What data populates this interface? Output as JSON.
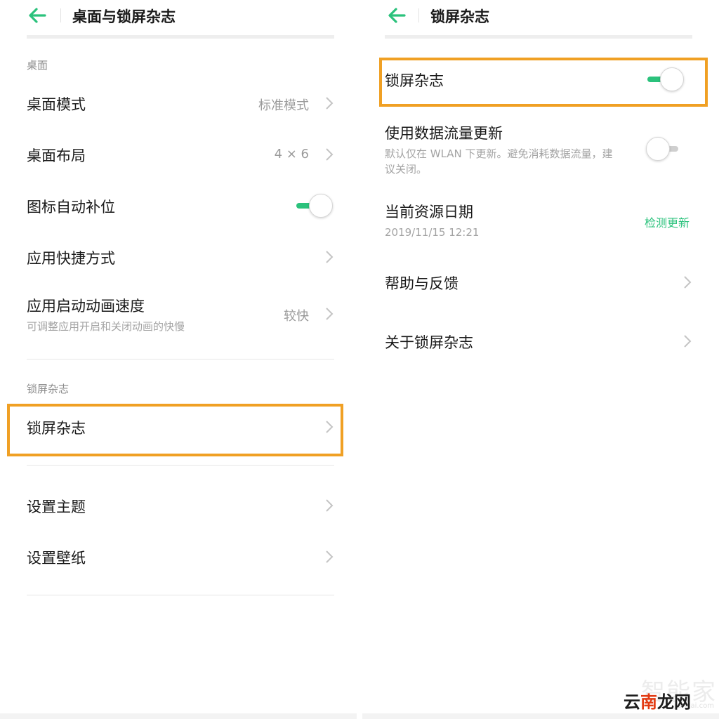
{
  "colors": {
    "accent": "#2bc27c",
    "highlight": "#f0a024",
    "watermark_accent": "#e23a12"
  },
  "icons": {
    "back": "arrow-left-icon",
    "chevron": "chevron-right-icon"
  },
  "left": {
    "title": "桌面与锁屏杂志",
    "section_desktop": "桌面",
    "rows": [
      {
        "title": "桌面模式",
        "value": "标准模式"
      },
      {
        "title": "桌面布局",
        "value": "4 × 6"
      },
      {
        "title": "图标自动补位",
        "toggle": "on"
      },
      {
        "title": "应用快捷方式"
      },
      {
        "title": "应用启动动画速度",
        "subtitle": "可调整应用开启和关闭动画的快慢",
        "value": "较快"
      }
    ],
    "section_lock": "锁屏杂志",
    "lock_row": {
      "title": "锁屏杂志"
    },
    "theme_row": {
      "title": "设置主题"
    },
    "wallpaper_row": {
      "title": "设置壁纸"
    }
  },
  "right": {
    "title": "锁屏杂志",
    "lock_toggle": {
      "title": "锁屏杂志",
      "toggle": "on"
    },
    "data_update": {
      "title": "使用数据流量更新",
      "subtitle_line1": "默认仅在 WLAN 下更新。避免消耗数据流量，建",
      "subtitle_line2": "议关闭。",
      "toggle": "off"
    },
    "resource_date": {
      "title": "当前资源日期",
      "date": "2019/11/15 12:21",
      "action": "检测更新"
    },
    "help": {
      "title": "帮助与反馈"
    },
    "about": {
      "title": "关于锁屏杂志"
    }
  },
  "watermark": {
    "faint": "智能家",
    "url": "jiancai.com",
    "main_prefix": "云",
    "main_highlight": "南",
    "main_suffix": "龙网"
  }
}
